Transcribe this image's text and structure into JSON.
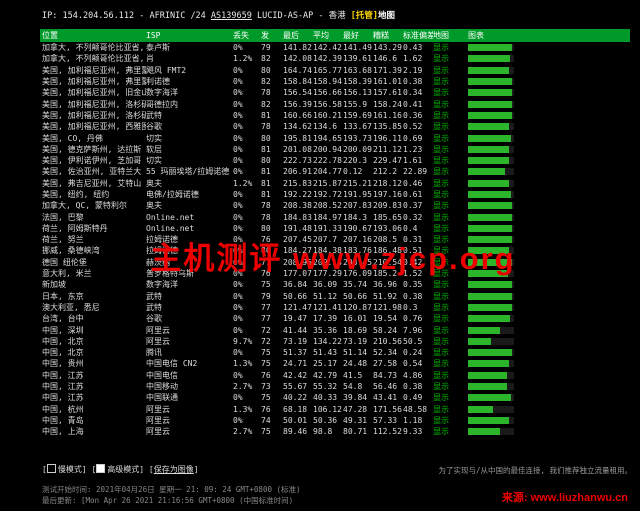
{
  "header": {
    "ip_prefix": "IP:",
    "ip": "154.204.56.112",
    "asn_pre": "- AFRINIC /24",
    "asn": "AS139659",
    "asn_post": "LUCID-AS-AP - 香港",
    "warn": "[托管]",
    "map": "地图"
  },
  "columns": [
    "位置",
    "ISP",
    "丢失",
    "发",
    "最后",
    "平均",
    "最好",
    "糟糕",
    "标准偏差",
    "地图",
    "图表"
  ],
  "rows": [
    {
      "loc": "加拿大, 不列颠哥伦比亚省, 温哥华",
      "isp": "泰卢斯",
      "loss": "0%",
      "sent": "79",
      "last": "141.82",
      "avg": "142.42",
      "best": "141.49",
      "worst": "143.29",
      "dev": "0.43",
      "map": "显示",
      "q": 0.95
    },
    {
      "loc": "加拿大, 不列颠哥伦比亚省, 温哥华",
      "isp": "肖",
      "loss": "1.2%",
      "sent": "82",
      "last": "142.08",
      "avg": "142.39",
      "best": "139.61",
      "worst": "146.6",
      "dev": "1.62",
      "map": "显示",
      "q": 0.92
    },
    {
      "loc": "美国, 加利福尼亚州, 弗里蒙特",
      "isp": "飓风 FMT2",
      "loss": "0%",
      "sent": "80",
      "last": "164.74",
      "avg": "165.77",
      "best": "163.68",
      "worst": "171.39",
      "dev": "2.19",
      "map": "显示",
      "q": 0.9
    },
    {
      "loc": "美国, 加利福尼亚州, 弗里蒙特",
      "isp": "利诺德",
      "loss": "0%",
      "sent": "82",
      "last": "158.84",
      "avg": "158.94",
      "best": "158.39",
      "worst": "161.01",
      "dev": "0.38",
      "map": "显示",
      "q": 0.96
    },
    {
      "loc": "美国, 加利福尼亚州, 旧金山",
      "isp": "数字海洋",
      "loss": "0%",
      "sent": "78",
      "last": "156.54",
      "avg": "156.66",
      "best": "156.13",
      "worst": "157.61",
      "dev": "0.34",
      "map": "显示",
      "q": 0.95
    },
    {
      "loc": "美国, 加利福尼亚州, 洛杉矶",
      "isp": "哥德拉内",
      "loss": "0%",
      "sent": "82",
      "last": "156.39",
      "avg": "156.58",
      "best": "155.9",
      "worst": "158.24",
      "dev": "0.41",
      "map": "显示",
      "q": 0.95
    },
    {
      "loc": "美国, 加利福尼亚州, 洛杉矶",
      "isp": "武特",
      "loss": "0%",
      "sent": "81",
      "last": "160.66",
      "avg": "160.21",
      "best": "159.69",
      "worst": "161.16",
      "dev": "0.36",
      "map": "显示",
      "q": 0.96
    },
    {
      "loc": "美国, 加利福尼亚州, 西雅图",
      "isp": "谷歌",
      "loss": "0%",
      "sent": "78",
      "last": "134.62",
      "avg": "134.6",
      "best": "133.67",
      "worst": "135.85",
      "dev": "0.52",
      "map": "显示",
      "q": 0.9
    },
    {
      "loc": "美国, CO, 丹佛",
      "isp": "切实",
      "loss": "0%",
      "sent": "80",
      "last": "195.81",
      "avg": "194.65",
      "best": "193.73",
      "worst": "196.11",
      "dev": "0.69",
      "map": "显示",
      "q": 0.93
    },
    {
      "loc": "美国, 德克萨斯州, 达拉斯",
      "isp": "软层",
      "loss": "0%",
      "sent": "81",
      "last": "201.08",
      "avg": "200.94",
      "best": "200.09",
      "worst": "211.12",
      "dev": "1.23",
      "map": "显示",
      "q": 0.9
    },
    {
      "loc": "美国, 伊利诺伊州, 芝加哥",
      "isp": "切实",
      "loss": "0%",
      "sent": "80",
      "last": "222.73",
      "avg": "222.78",
      "best": "220.3",
      "worst": "229.47",
      "dev": "1.61",
      "map": "显示",
      "q": 0.9
    },
    {
      "loc": "美国, 佐治亚州, 亚特兰大",
      "isp": "55 玛丽埃塔/拉姆诺德",
      "loss": "0%",
      "sent": "81",
      "last": "206.91",
      "avg": "204.77",
      "best": "0.12",
      "worst": "212.2",
      "dev": "22.89",
      "map": "显示",
      "q": 0.8
    },
    {
      "loc": "美国, 弗吉尼亚州, 艾特山",
      "isp": "奥夫",
      "loss": "1.2%",
      "sent": "81",
      "last": "215.83",
      "avg": "215.87",
      "best": "215.21",
      "worst": "218.12",
      "dev": "0.46",
      "map": "显示",
      "q": 0.9
    },
    {
      "loc": "美国, 纽约, 纽约",
      "isp": "电佛/拉姆诺德",
      "loss": "0%",
      "sent": "81",
      "last": "192.22",
      "avg": "192.72",
      "best": "191.95",
      "worst": "197.16",
      "dev": "0.61",
      "map": "显示",
      "q": 0.93
    },
    {
      "loc": "加拿大, QC, 蒙特利尔",
      "isp": "奥夫",
      "loss": "0%",
      "sent": "78",
      "last": "208.38",
      "avg": "208.52",
      "best": "207.83",
      "worst": "209.83",
      "dev": "0.37",
      "map": "显示",
      "q": 0.95
    },
    {
      "loc": "法国, 巴黎",
      "isp": "Online.net",
      "loss": "0%",
      "sent": "78",
      "last": "184.83",
      "avg": "184.97",
      "best": "184.3",
      "worst": "185.65",
      "dev": "0.32",
      "map": "显示",
      "q": 0.95
    },
    {
      "loc": "荷兰, 阿姆斯特丹",
      "isp": "Online.net",
      "loss": "0%",
      "sent": "80",
      "last": "191.48",
      "avg": "191.33",
      "best": "190.67",
      "worst": "193.06",
      "dev": "0.4",
      "map": "显示",
      "q": 0.95
    },
    {
      "loc": "荷兰, 努兰",
      "isp": "拉姆诺德",
      "loss": "0%",
      "sent": "76",
      "last": "207.45",
      "avg": "207.7",
      "best": "207.16",
      "worst": "208.5",
      "dev": "0.31",
      "map": "显示",
      "q": 0.95
    },
    {
      "loc": "挪威, 桑德峡湾",
      "isp": "拉姆诺德",
      "loss": "0%",
      "sent": "80",
      "last": "184.27",
      "avg": "184.38",
      "best": "183.76",
      "worst": "186.48",
      "dev": "0.51",
      "map": "显示",
      "q": 0.9
    },
    {
      "loc": "德国 纽伦堡",
      "isp": "赫茨纳",
      "loss": "0%",
      "sent": "77",
      "last": "208.95",
      "avg": "209.13",
      "best": "208.45",
      "worst": "210.54",
      "dev": "0.42",
      "map": "显示",
      "q": 0.95
    },
    {
      "loc": "意大利, 米兰",
      "isp": "普罗格特乌斯",
      "loss": "0%",
      "sent": "76",
      "last": "177.07",
      "avg": "177.29",
      "best": "176.09",
      "worst": "185.2",
      "dev": "1.52",
      "map": "显示",
      "q": 0.88
    },
    {
      "loc": "新加坡",
      "isp": "数字海洋",
      "loss": "0%",
      "sent": "75",
      "last": "36.84",
      "avg": "36.09",
      "best": "35.74",
      "worst": "36.96",
      "dev": "0.35",
      "map": "显示",
      "q": 0.95
    },
    {
      "loc": "日本, 东京",
      "isp": "武特",
      "loss": "0%",
      "sent": "79",
      "last": "50.66",
      "avg": "51.12",
      "best": "50.66",
      "worst": "51.92",
      "dev": "0.38",
      "map": "显示",
      "q": 0.95
    },
    {
      "loc": "澳大利亚, 悉尼",
      "isp": "武特",
      "loss": "0%",
      "sent": "77",
      "last": "121.47",
      "avg": "121.41",
      "best": "120.87",
      "worst": "121.98",
      "dev": "0.3",
      "map": "显示",
      "q": 0.96
    },
    {
      "loc": "台湾, 台中",
      "isp": "谷歌",
      "loss": "0%",
      "sent": "77",
      "last": "19.47",
      "avg": "17.39",
      "best": "16.01",
      "worst": "19.54",
      "dev": "0.76",
      "map": "显示",
      "q": 0.92
    },
    {
      "loc": "中国, 深圳",
      "isp": "阿里云",
      "loss": "0%",
      "sent": "72",
      "last": "41.44",
      "avg": "35.36",
      "best": "18.69",
      "worst": "58.24",
      "dev": "7.96",
      "map": "显示",
      "q": 0.7
    },
    {
      "loc": "中国, 北京",
      "isp": "阿里云",
      "loss": "9.7%",
      "sent": "72",
      "last": "73.19",
      "avg": "134.22",
      "best": "73.19",
      "worst": "210.56",
      "dev": "50.5",
      "map": "显示",
      "q": 0.5
    },
    {
      "loc": "中国, 北京",
      "isp": "腾讯",
      "loss": "0%",
      "sent": "75",
      "last": "51.37",
      "avg": "51.43",
      "best": "51.14",
      "worst": "52.34",
      "dev": "0.24",
      "map": "显示",
      "q": 0.96
    },
    {
      "loc": "中国, 贵州",
      "isp": "中国电信 CN2",
      "loss": "1.3%",
      "sent": "75",
      "last": "24.71",
      "avg": "25.17",
      "best": "24.48",
      "worst": "27.58",
      "dev": "0.54",
      "map": "显示",
      "q": 0.9
    },
    {
      "loc": "中国, 江苏",
      "isp": "中国电信",
      "loss": "0%",
      "sent": "76",
      "last": "42.42",
      "avg": "42.79",
      "best": "41.5",
      "worst": "84.73",
      "dev": "4.86",
      "map": "显示",
      "q": 0.85
    },
    {
      "loc": "中国, 江苏",
      "isp": "中国移动",
      "loss": "2.7%",
      "sent": "73",
      "last": "55.67",
      "avg": "55.32",
      "best": "54.8",
      "worst": "56.46",
      "dev": "0.38",
      "map": "显示",
      "q": 0.85
    },
    {
      "loc": "中国, 江苏",
      "isp": "中国联通",
      "loss": "0%",
      "sent": "75",
      "last": "40.22",
      "avg": "40.33",
      "best": "39.84",
      "worst": "43.41",
      "dev": "0.49",
      "map": "显示",
      "q": 0.93
    },
    {
      "loc": "中国, 杭州",
      "isp": "阿里云",
      "loss": "1.3%",
      "sent": "76",
      "last": "68.18",
      "avg": "106.12",
      "best": "47.28",
      "worst": "171.56",
      "dev": "48.58",
      "map": "显示",
      "q": 0.55
    },
    {
      "loc": "中国, 青岛",
      "isp": "阿里云",
      "loss": "0%",
      "sent": "74",
      "last": "50.01",
      "avg": "50.36",
      "best": "49.31",
      "worst": "57.33",
      "dev": "1.18",
      "map": "显示",
      "q": 0.9
    },
    {
      "loc": "中国, 上海",
      "isp": "阿里云",
      "loss": "2.7%",
      "sent": "75",
      "last": "89.46",
      "avg": "98.8",
      "best": "80.71",
      "worst": "112.52",
      "dev": "9.33",
      "map": "显示",
      "q": 0.7
    }
  ],
  "watermark": "主机测评 www.zjcp.org",
  "footer": {
    "check1": "慢模式",
    "check2": "高级模式",
    "save": "保存为图像",
    "note": "为了实现与/从中国的最佳连接, 我们推荐独立流量租用。",
    "time1": "测试开始时间: 2021年04月26日 星期一 21: 09: 24 GMT+0800 (标准)",
    "time2": "最后更新: [Mon Apr 26 2021 21:16:56 GMT+0800 (中国标准时间)",
    "watermark2": "来源: www.liuzhanwu.cn"
  }
}
